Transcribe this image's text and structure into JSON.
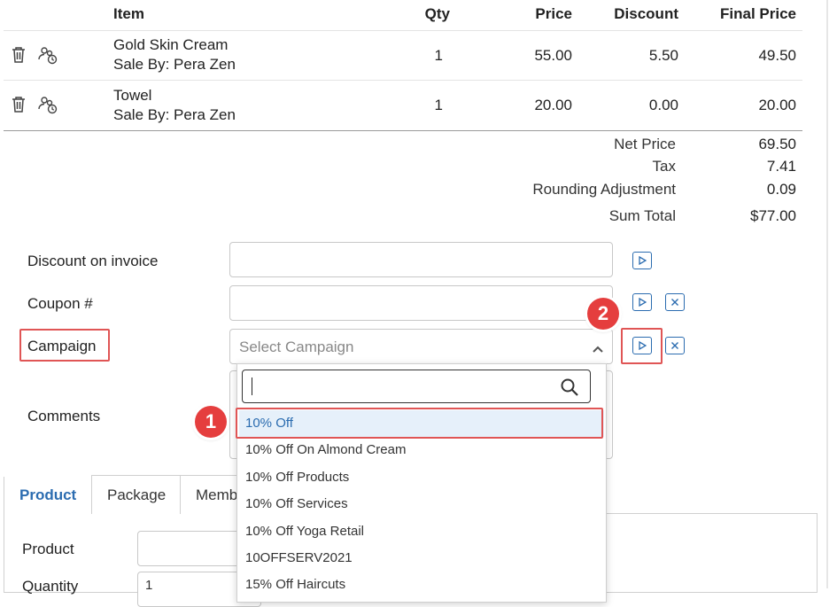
{
  "table": {
    "headers": {
      "item": "Item",
      "qty": "Qty",
      "price": "Price",
      "discount": "Discount",
      "final_price": "Final Price"
    },
    "rows": [
      {
        "name": "Gold Skin Cream",
        "sale_by": "Sale By: Pera Zen",
        "qty": "1",
        "price": "55.00",
        "discount": "5.50",
        "final_price": "49.50"
      },
      {
        "name": "Towel",
        "sale_by": "Sale By: Pera Zen",
        "qty": "1",
        "price": "20.00",
        "discount": "0.00",
        "final_price": "20.00"
      }
    ]
  },
  "summary": {
    "net_price_label": "Net Price",
    "net_price": "69.50",
    "tax_label": "Tax",
    "tax": "7.41",
    "rounding_label": "Rounding Adjustment",
    "rounding": "0.09",
    "sum_total_label": "Sum Total",
    "sum_total": "$77.00"
  },
  "form": {
    "discount_label": "Discount on invoice",
    "discount_value": "",
    "coupon_label": "Coupon #",
    "coupon_value": "",
    "campaign_label": "Campaign",
    "campaign_placeholder": "Select Campaign",
    "comments_label": "Comments"
  },
  "campaign_dropdown": {
    "search_value": "",
    "options": [
      "10% Off",
      "10% Off On Almond Cream",
      "10% Off Products",
      "10% Off Services",
      "10% Off Yoga Retail",
      "10OFFSERV2021",
      "15% Off Haircuts"
    ],
    "selected_index": 0
  },
  "tabs": {
    "product": "Product",
    "package": "Package",
    "membership_partial": "Memb"
  },
  "product_form": {
    "product_label": "Product",
    "quantity_label": "Quantity",
    "quantity_value": "1"
  },
  "callouts": {
    "one": "1",
    "two": "2"
  },
  "colors": {
    "accent": "#2b6cb0",
    "callout_red": "#e53e3e",
    "highlight_bg": "#e6f0fa"
  },
  "icons": [
    "trash-icon",
    "staff-assign-icon",
    "play-icon",
    "close-icon",
    "search-icon",
    "chevron-up-icon"
  ]
}
